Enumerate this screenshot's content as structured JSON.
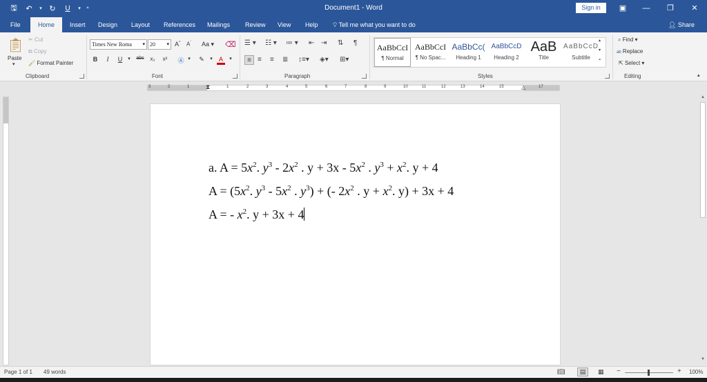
{
  "app": {
    "doc_title": "Document1  -  Word",
    "sign_in": "Sign in",
    "share": "Share",
    "tell_me": "Tell me what you want to do",
    "qat": {
      "save": "🖫",
      "undo": "↶",
      "redo": "↻",
      "underline": "U"
    }
  },
  "tabs": [
    "File",
    "Home",
    "Insert",
    "Design",
    "Layout",
    "References",
    "Mailings",
    "Review",
    "View",
    "Help"
  ],
  "ribbon": {
    "clipboard": {
      "label": "Clipboard",
      "paste": "Paste",
      "cut": "Cut",
      "copy": "Copy",
      "format_painter": "Format Painter"
    },
    "font": {
      "label": "Font",
      "font_name": "Times New Roma",
      "font_size": "20",
      "bold": "B",
      "italic": "I",
      "underline": "U",
      "strike": "abc",
      "subscript": "x₂",
      "superscript": "x²",
      "change_case": "Aa"
    },
    "paragraph": {
      "label": "Paragraph"
    },
    "styles": {
      "label": "Styles",
      "items": [
        {
          "preview": "AaBbCcI",
          "name": "¶ Normal"
        },
        {
          "preview": "AaBbCcI",
          "name": "¶ No Spac..."
        },
        {
          "preview": "AaBbCc(",
          "name": "Heading 1"
        },
        {
          "preview": "AaBbCcD",
          "name": "Heading 2"
        },
        {
          "preview": "AaB",
          "name": "Title"
        },
        {
          "preview": "AaBbCcD",
          "name": "Subtitle"
        }
      ]
    },
    "editing": {
      "label": "Editing",
      "find": "Find",
      "replace": "Replace",
      "select": "Select"
    }
  },
  "ruler": {
    "numbers": [
      "3",
      "2",
      "1",
      "1",
      "2",
      "3",
      "4",
      "5",
      "6",
      "7",
      "8",
      "9",
      "10",
      "11",
      "12",
      "13",
      "14",
      "15",
      "17"
    ]
  },
  "document": {
    "line1": {
      "lead": "a. A = 5",
      "p1": ". ",
      "p2": " - 2",
      "p3": " . y + 3x - 5",
      "p4": " . ",
      "p5": " + ",
      "p6": ". y + 4"
    },
    "line2": {
      "lead": "A = (5",
      "p1": ". ",
      "p2": " - 5",
      "p3": " . ",
      "p4": ") + (- 2",
      "p5": " . y + ",
      "p6": ". y) + 3x + 4"
    },
    "line3": {
      "lead": "A = - ",
      "p1": ". y + 3x + 4"
    },
    "var_x": "x",
    "var_y": "y",
    "exp2": "2",
    "exp3": "3"
  },
  "status": {
    "page": "Page 1 of 1",
    "words": "49 words",
    "zoom": "100%"
  },
  "colors": {
    "word_blue": "#2b579a",
    "ribbon_bg": "#f3f3f3"
  }
}
